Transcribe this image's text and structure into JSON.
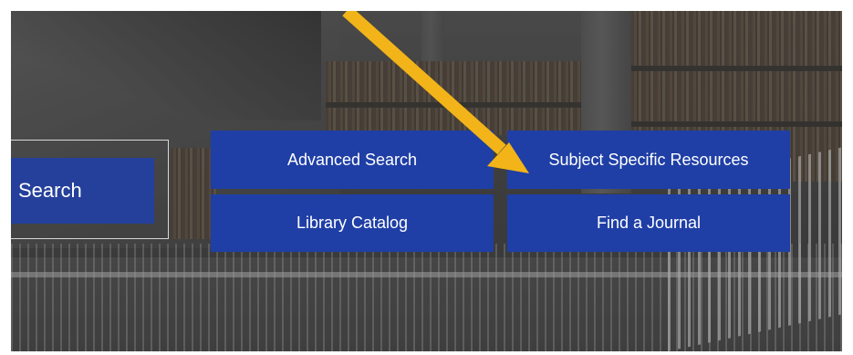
{
  "search": {
    "button_label": "Search"
  },
  "tiles": [
    {
      "label": "Advanced Search"
    },
    {
      "label": "Subject Specific Resources"
    },
    {
      "label": "Library Catalog"
    },
    {
      "label": "Find a Journal"
    }
  ],
  "annotation": {
    "arrow_color": "#f2b418",
    "target": "Subject Specific Resources"
  },
  "colors": {
    "tile_background": "#1f3fa6",
    "search_outline": "#d8d8d8"
  }
}
